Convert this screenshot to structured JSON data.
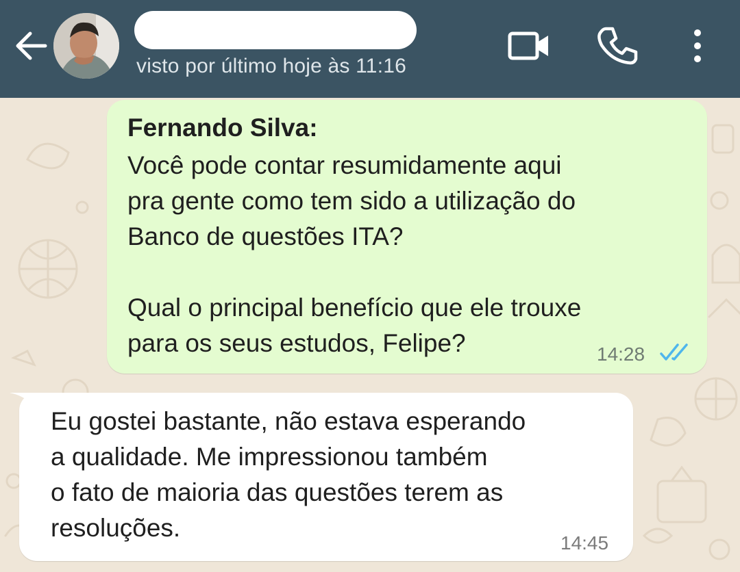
{
  "header": {
    "status": "visto por último hoje às 11:16"
  },
  "messages": {
    "outgoing": {
      "sender": "Fernando Silva:",
      "text": "Você pode contar resumidamente aqui\npra gente como tem sido a utilização do\nBanco de questões ITA?\n\nQual o principal benefício que ele trouxe\npara os seus estudos, Felipe?",
      "time": "14:28",
      "status_icon": "double-check-read-icon"
    },
    "incoming": {
      "text": "Eu gostei bastante, não estava esperando\na qualidade. Me impressionou também\no fato de maioria das questões terem as\nresoluções.",
      "time": "14:45"
    }
  },
  "colors": {
    "header": "#3b5463",
    "wallpaper": "#efe6d8",
    "outgoing_bubble": "#e4fcd0",
    "incoming_bubble": "#ffffff",
    "read_ticks": "#4fb6ec"
  },
  "icons": [
    "back-arrow-icon",
    "video-call-icon",
    "phone-icon",
    "more-options-icon"
  ]
}
